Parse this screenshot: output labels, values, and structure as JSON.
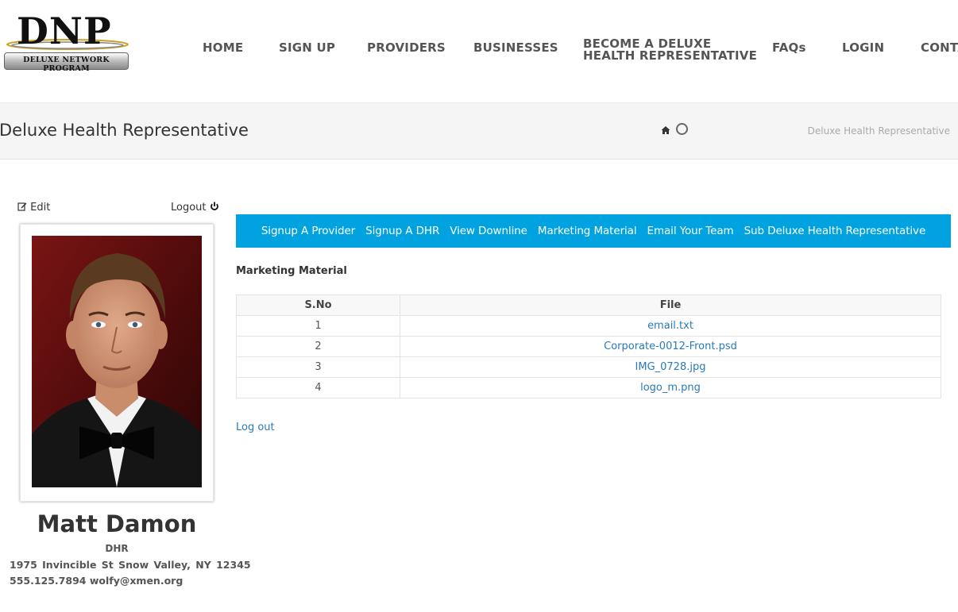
{
  "logo": {
    "brand": "DNP",
    "tagline": "DELUXE NETWORK PROGRAM"
  },
  "nav": {
    "home": "HOME",
    "signup": "SIGN UP",
    "providers": "PROVIDERS",
    "businesses": "BUSINESSES",
    "become_line1": "BECOME A DELUXE",
    "become_line2": "HEALTH REPRESENTATIVE",
    "faqs": "FAQs",
    "login": "LOGIN",
    "contact": "CONTA"
  },
  "page": {
    "title": "Deluxe Health Representative",
    "breadcrumb_current": "Deluxe Health Representative"
  },
  "sidebar": {
    "edit_label": "Edit",
    "logout_label": "Logout",
    "name": "Matt Damon",
    "role": "DHR",
    "address": "1975 Invincible St Snow Valley, NY 12345",
    "phone": "555.125.7894",
    "email": "wolfy@xmen.org"
  },
  "subnav": {
    "items": [
      "Signup A Provider",
      "Signup A DHR",
      "View Downline",
      "Marketing Material",
      "Email Your Team",
      "Sub Deluxe Health Representative"
    ]
  },
  "main": {
    "section_title": "Marketing Material",
    "table": {
      "headers": [
        "S.No",
        "File"
      ],
      "rows": [
        {
          "sno": "1",
          "file": "email.txt"
        },
        {
          "sno": "2",
          "file": "Corporate-0012-Front.psd"
        },
        {
          "sno": "3",
          "file": "IMG_0728.jpg"
        },
        {
          "sno": "4",
          "file": "logo_m.png"
        }
      ]
    },
    "logout_label": "Log out"
  },
  "colors": {
    "accent": "#00a3e0",
    "link": "#2a7ab8",
    "titlebar_bg": "#f5f5f5"
  }
}
